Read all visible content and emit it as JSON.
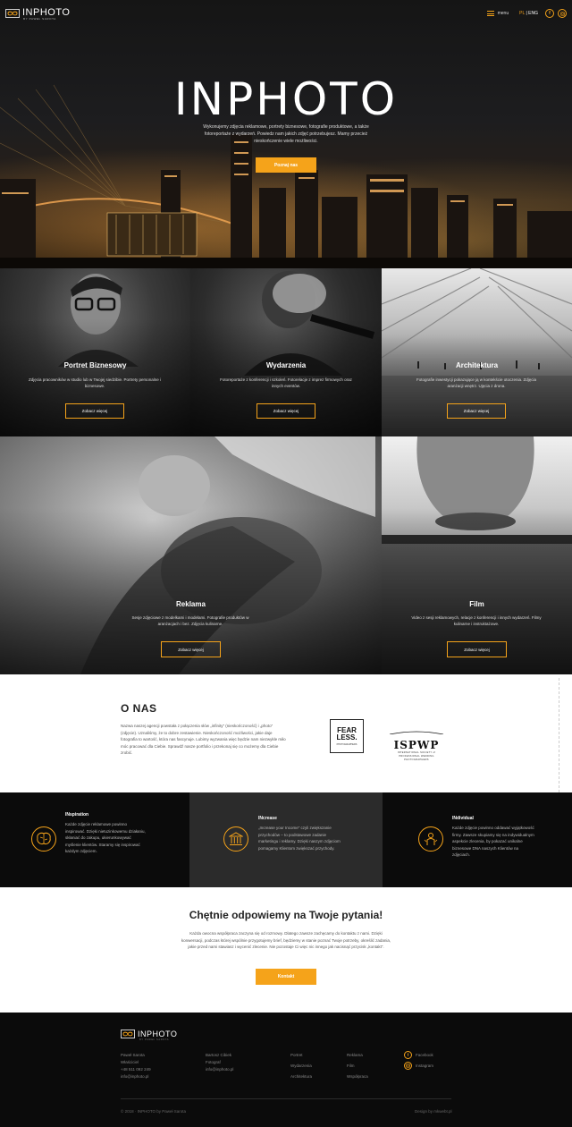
{
  "brand": {
    "name_prefix": "IN",
    "name_suffix": "PHOTO",
    "tagline": "BY PAWEŁ SAROTA",
    "accent_color": "#f5a31a"
  },
  "nav": {
    "menu_label": "menu",
    "lang_active": "PL",
    "lang_separator": "|",
    "lang_other": "ENG",
    "social_icons": [
      "facebook-icon",
      "instagram-icon"
    ]
  },
  "hero": {
    "title": "INPHOTO",
    "description": "Wykonujemy zdjęcia reklamowe, portrety biznesowe, fotografie produktowe, a także fotoreportaże z wydarzeń. Powiedz nam jakich zdjęć potrzebujesz. Mamy przecież nieskończenie wiele możliwości.",
    "cta_label": "Poznaj nas"
  },
  "categories": [
    {
      "title": "Portret Biznesowy",
      "desc": "Zdjęcia pracowników w studio lub w Twojej siedzibie. Portrety personalne i biznesowe.",
      "button": "Zobacz więcej"
    },
    {
      "title": "Wydarzenia",
      "desc": "Fotoreportaże z konferencji i szkoleń. Fotorelacje z imprez firmowych oraz innych eventów.",
      "button": "Zobacz więcej"
    },
    {
      "title": "Architektura",
      "desc": "Fotografie inwestycji pokazujące ją w kontekście otoczenia. Zdjęcia aranżacji wnętrz. Ujęcia z drona.",
      "button": "Zobacz więcej"
    },
    {
      "title": "Reklama",
      "desc": "Sesje zdjęciowe z modelkami i modelami. Fotografie produktów w aranżacjach i bez. Zdjęcia kulinarne.",
      "button": "Zobacz więcej"
    },
    {
      "title": "Film",
      "desc": "Video z sesji reklamowych, relacje z konferencji i innych wydarzeń. Filmy kulinarne i instruktażowe.",
      "button": "Zobacz więcej"
    }
  ],
  "about": {
    "title": "O NAS",
    "text": "Nazwa naszej agencji powstała z połączenia słów „infinity” (nieskończoność) i „photo” (zdjęcie). Uznaliśmy, że to dobre zestawienie. Nieskończoność możliwości, jakie daje fotografia to wartość, która nas fascynuje. Lubimy wyzwania więc będzie nam niezwykle miło móc pracować dla Ciebie. Sprawdź nasze portfolio i przekonaj się co możemy dla Ciebie zrobić.",
    "badge1_main": "FEAR LESS.",
    "badge1_sub": "PHOTOGRAPHERS",
    "badge2_main": "ISPWP",
    "badge2_sub": "INTERNATIONAL SOCIETY of PROFESSIONAL WEDDING PHOTOGRAPHERS"
  },
  "features": [
    {
      "title": "INspiration",
      "text": "Każde zdjęcie reklamowe powinno inspirować. Dzięki nietuzinkowemu działaniu, skłaniać do zakupu, ukierunkowywać myślenie klientów. Staramy się inspirować każdym zdjęciem.",
      "icon": "brain-icon",
      "bg": "#0b0b0b"
    },
    {
      "title": "INcrease",
      "text": "„Increase your Income” czyli zwiększanie przychodów – to podstawowe zadanie marketingu i reklamy. Dzięki naszym zdjęciom pomagamy Klientom zwiększać przychody.",
      "icon": "bank-icon",
      "bg": "#2b2b2b"
    },
    {
      "title": "INdividual",
      "text": "Każde zdjęcie powinno oddawać wyjątkowość firmy. Zawsze skupiamy się na indywidualnym aspekcie zlecenia, by pokazać unikalne biznesowe DNA naszych Klientów na zdjęciach.",
      "icon": "person-icon",
      "bg": "#0b0b0b"
    }
  ],
  "contact": {
    "title": "Chętnie odpowiemy na Twoje pytania!",
    "text": "Każda owocna współpraca zaczyna się od rozmowy. Dlatego zawsze zachęcamy do kontaktu z nami. Dzięki konwersacji, podczas której wspólnie przygotujemy brief, będziemy w stanie poznać Twoje potrzeby, określić zadania, jakie przed nami stawiasz i wycenić zlecenie. Nie pozostaje Ci więc nic innego jak nacisnąć przycisk „kontakt”.",
    "button": "Kontakt"
  },
  "footer": {
    "col1": [
      "Paweł Sarota",
      "Właściciel",
      "+48 511 092 249",
      "info@inphoto.pl"
    ],
    "col2": [
      "Bartosz Cibiek",
      "Fotograf",
      "info@inphoto.pl"
    ],
    "col3": [
      "Portret",
      "Wydarzenia",
      "Architektura"
    ],
    "col4": [
      "Reklama",
      "Film",
      "Współpraca"
    ],
    "social": [
      {
        "icon": "facebook-icon",
        "label": "Facebook"
      },
      {
        "icon": "instagram-icon",
        "label": "Instagram"
      }
    ],
    "copyright": "© 2018 · INPHOTO by Paweł Sarota",
    "credit": "Design by mkwebt.pl"
  }
}
